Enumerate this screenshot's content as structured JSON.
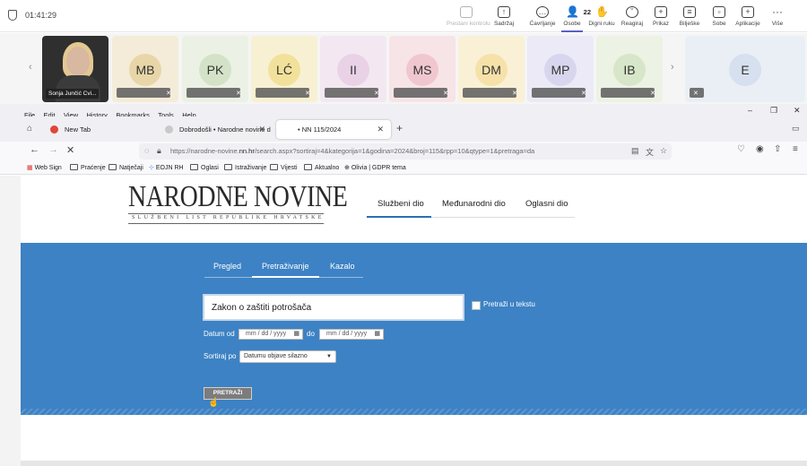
{
  "teams": {
    "timer": "01:41:29",
    "tools": [
      {
        "label": "Prestani kontrolu",
        "icon": "cast-icon"
      },
      {
        "label": "Sadržaj",
        "icon": "share-icon"
      },
      {
        "label": "Ćavrljanje",
        "icon": "chat-icon"
      },
      {
        "label": "Osobe",
        "icon": "people-icon",
        "count": "22"
      },
      {
        "label": "Digni ruku",
        "icon": "raise-hand-icon"
      },
      {
        "label": "Reagiraj",
        "icon": "emoji-icon"
      },
      {
        "label": "Prikaz",
        "icon": "view-icon"
      },
      {
        "label": "Bilješke",
        "icon": "notes-icon"
      },
      {
        "label": "Sobe",
        "icon": "rooms-icon"
      },
      {
        "label": "Aplikacije",
        "icon": "apps-icon"
      },
      {
        "label": "Više",
        "icon": "more-icon"
      }
    ]
  },
  "gallery": {
    "video_name": "Sonja Junčić Cvi...",
    "participants": [
      {
        "initials": "MB",
        "color": "#e8d6a8"
      },
      {
        "initials": "PK",
        "color": "#d4e3c7"
      },
      {
        "initials": "LĆ",
        "color": "#f2e19a"
      },
      {
        "initials": "II",
        "color": "#ead2e6"
      },
      {
        "initials": "MS",
        "color": "#f0c7cf"
      },
      {
        "initials": "DM",
        "color": "#f6e1a9"
      },
      {
        "initials": "MP",
        "color": "#d8d6ee"
      },
      {
        "initials": "IB",
        "color": "#d7e6c8"
      },
      {
        "initials": "E",
        "color": "#d6e0ee"
      }
    ]
  },
  "firefox": {
    "menu": [
      "File",
      "Edit",
      "View",
      "History",
      "Bookmarks",
      "Tools",
      "Help"
    ],
    "tabs": [
      {
        "title": "New Tab"
      },
      {
        "title": "Dobrodošli • Narodne novine d"
      },
      {
        "title": "• NN 115/2024"
      }
    ],
    "url_prefix": "https://narodne-novine.",
    "url_domain": "nn.hr",
    "url_rest": "/search.aspx?sortiraj=4&kategorija=1&godina=2024&broj=115&rpp=10&qtype=1&pretraga=da",
    "bookmarks": [
      "Web Sign",
      "Praćenje",
      "Natječaji",
      "EOJN RH",
      "Oglasi",
      "Istraživanje",
      "Vijesti",
      "Aktualno",
      "Olivia | GDPR tema"
    ]
  },
  "page": {
    "logo_title": "NARODNE NOVINE",
    "logo_subtitle": "SLUŽBENI LIST REPUBLIKE HRVATSKE",
    "sections": [
      "Službeni dio",
      "Međunarodni dio",
      "Oglasni dio"
    ],
    "subtabs": [
      "Pregled",
      "Pretraživanje",
      "Kazalo"
    ],
    "search_value": "Zakon o zaštiti potrošača",
    "fulltext_label": "Pretraži u tekstu",
    "date_from_label": "Datum od",
    "date_to_label": "do",
    "date_placeholder": "mm / dd / yyyy",
    "sort_label": "Sortiraj po",
    "sort_value": "Datumu objave silazno",
    "search_button": "PRETRAŽI"
  }
}
